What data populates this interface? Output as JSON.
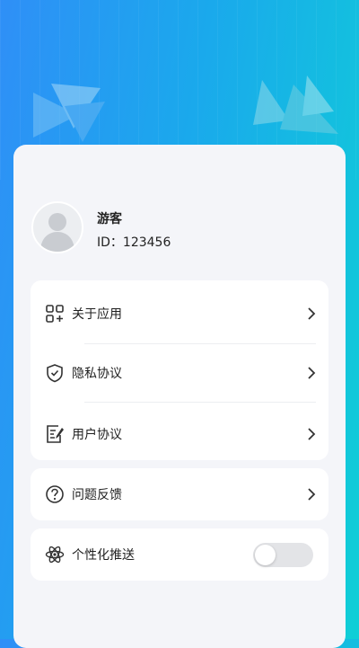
{
  "profile": {
    "nickname": "游客",
    "id_text": "ID：123456"
  },
  "menu": {
    "about": "关于应用",
    "privacy": "隐私协议",
    "user_agreement": "用户协议",
    "feedback": "问题反馈",
    "push": "个性化推送"
  },
  "push_toggle": {
    "on": false
  },
  "icons": {
    "about": "grid-icon",
    "privacy": "shield-icon",
    "user_agreement": "document-edit-icon",
    "feedback": "question-icon",
    "push": "atom-icon",
    "chevron": "chevron-right-icon",
    "avatar": "user-silhouette-icon"
  },
  "colors": {
    "header_gradient_start": "#2f8ff7",
    "header_gradient_end": "#0fcfd6",
    "panel_bg": "#f4f5f9",
    "card_bg": "#ffffff",
    "toggle_off": "#e3e4e7"
  }
}
